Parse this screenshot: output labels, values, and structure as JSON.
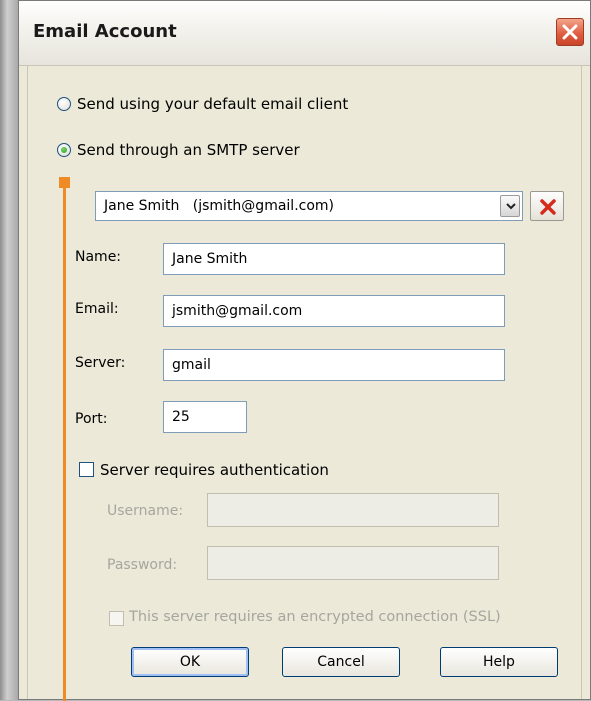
{
  "window": {
    "title": "Email Account"
  },
  "send_options": {
    "default_client_label": "Send using your default email client",
    "smtp_label": "Send through an SMTP server",
    "selected": "smtp"
  },
  "account_select": {
    "value": "Jane Smith   (jsmith@gmail.com)"
  },
  "fields": {
    "name": {
      "label": "Name:",
      "value": "Jane Smith"
    },
    "email": {
      "label": "Email:",
      "value": "jsmith@gmail.com"
    },
    "server": {
      "label": "Server:",
      "value": "gmail"
    },
    "port": {
      "label": "Port:",
      "value": "25"
    }
  },
  "auth": {
    "label": "Server requires authentication",
    "checked": false,
    "username_label": "Username:",
    "password_label": "Password:"
  },
  "ssl": {
    "label": "This server requires an encrypted connection (SSL)",
    "checked": false
  },
  "buttons": {
    "ok": "OK",
    "cancel": "Cancel",
    "help": "Help"
  },
  "colors": {
    "accent_orange": "#f08a24",
    "close_red": "#e0593c",
    "delete_red": "#d42c1c"
  },
  "icons": {
    "close": "close-icon",
    "dropdown": "chevron-down-icon",
    "delete": "delete-x-icon"
  }
}
